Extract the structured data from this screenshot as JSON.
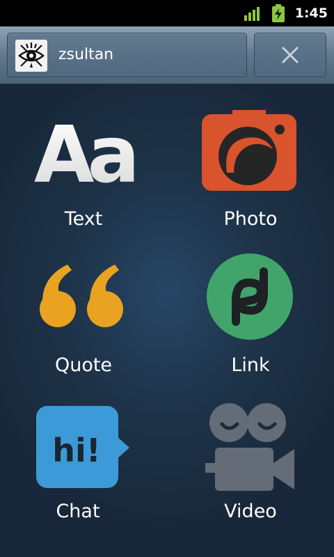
{
  "status_bar": {
    "time": "1:45",
    "signal_icon": "signal-bars-icon",
    "battery_icon": "battery-charging-icon",
    "accent_color": "#8dc63f"
  },
  "header": {
    "username": "zsultan",
    "avatar_icon": "eye-logo-avatar",
    "close_icon": "close-x-icon"
  },
  "post_types": [
    {
      "label": "Text",
      "icon": "text-aa-icon"
    },
    {
      "label": "Photo",
      "icon": "camera-icon",
      "color": "#d9532c"
    },
    {
      "label": "Quote",
      "icon": "quote-marks-icon",
      "color": "#e9a321"
    },
    {
      "label": "Link",
      "icon": "link-infinity-icon",
      "color": "#41a56b"
    },
    {
      "label": "Chat",
      "icon": "chat-bubble-hi-icon",
      "icon_text": "hi!",
      "color": "#3d9ad8"
    },
    {
      "label": "Video",
      "icon": "video-camera-icon",
      "color": "#636c77"
    }
  ]
}
